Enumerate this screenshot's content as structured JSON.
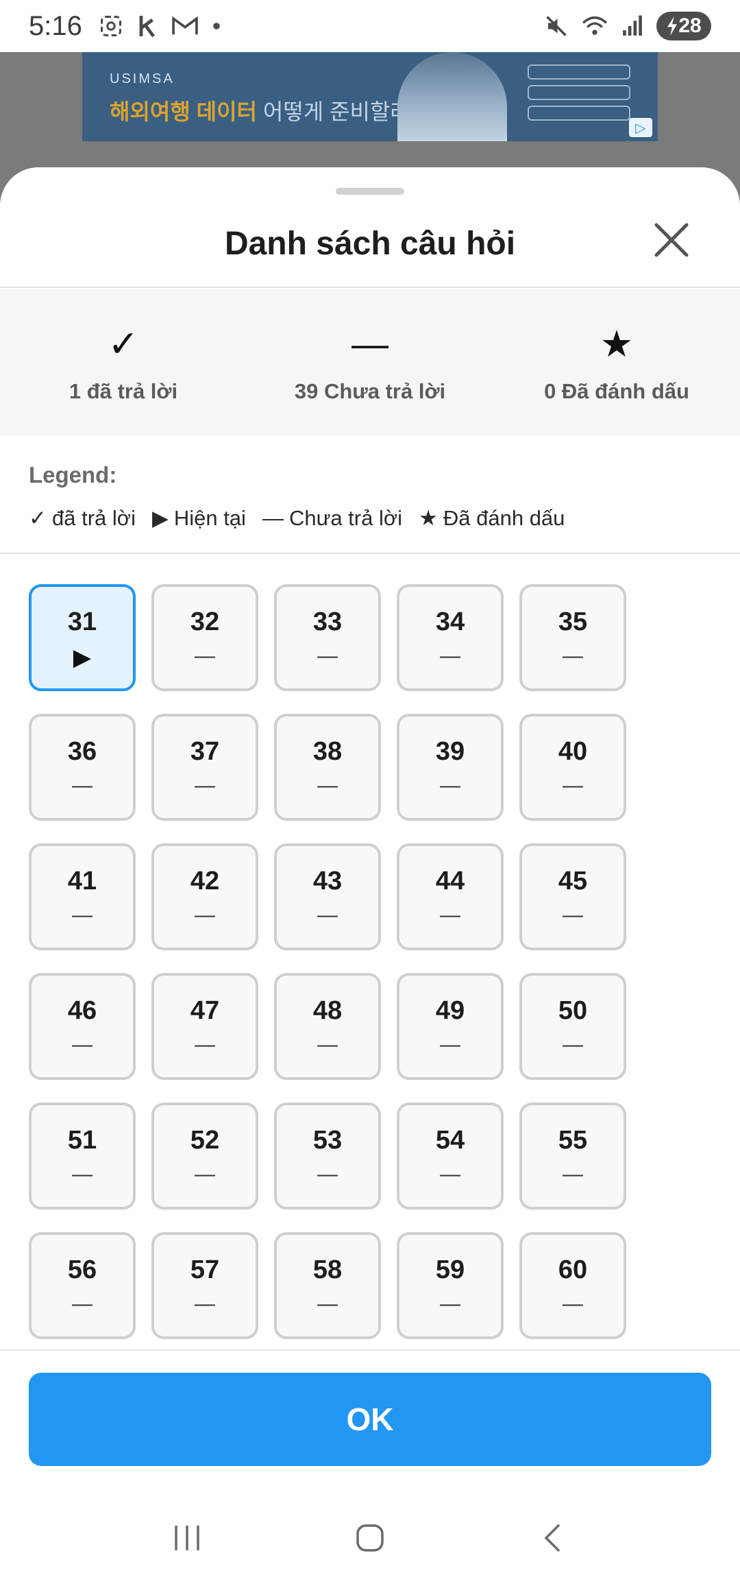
{
  "status_bar": {
    "time": "5:16",
    "left_icons": [
      "screenshot-icon",
      "k-app-icon",
      "gmail-icon",
      "dot-icon"
    ],
    "right_icons": [
      "mute-icon",
      "wifi-icon",
      "signal-icon"
    ],
    "battery": "28"
  },
  "ad": {
    "brand": "USIMSA",
    "headline_highlight": "해외여행 데이터",
    "headline_rest": " 어떻게 준비할래?"
  },
  "sheet": {
    "title": "Danh sách câu hỏi",
    "close_icon": "close-icon"
  },
  "summary": [
    {
      "icon": "✓",
      "label": "1 đã trả lời"
    },
    {
      "icon": "—",
      "label": "39 Chưa trả lời"
    },
    {
      "icon": "★",
      "label": "0 Đã đánh dấu"
    }
  ],
  "legend": {
    "title": "Legend:",
    "items": [
      {
        "icon": "✓",
        "label": "đã trả lời"
      },
      {
        "icon": "▶",
        "label": "Hiện tại"
      },
      {
        "icon": "—",
        "label": "Chưa trả lời"
      },
      {
        "icon": "★",
        "label": "Đã đánh dấu"
      }
    ]
  },
  "questions": [
    {
      "number": "31",
      "status": "▶",
      "current": true
    },
    {
      "number": "32",
      "status": "—",
      "current": false
    },
    {
      "number": "33",
      "status": "—",
      "current": false
    },
    {
      "number": "34",
      "status": "—",
      "current": false
    },
    {
      "number": "35",
      "status": "—",
      "current": false
    },
    {
      "number": "36",
      "status": "—",
      "current": false
    },
    {
      "number": "37",
      "status": "—",
      "current": false
    },
    {
      "number": "38",
      "status": "—",
      "current": false
    },
    {
      "number": "39",
      "status": "—",
      "current": false
    },
    {
      "number": "40",
      "status": "—",
      "current": false
    },
    {
      "number": "41",
      "status": "—",
      "current": false
    },
    {
      "number": "42",
      "status": "—",
      "current": false
    },
    {
      "number": "43",
      "status": "—",
      "current": false
    },
    {
      "number": "44",
      "status": "—",
      "current": false
    },
    {
      "number": "45",
      "status": "—",
      "current": false
    },
    {
      "number": "46",
      "status": "—",
      "current": false
    },
    {
      "number": "47",
      "status": "—",
      "current": false
    },
    {
      "number": "48",
      "status": "—",
      "current": false
    },
    {
      "number": "49",
      "status": "—",
      "current": false
    },
    {
      "number": "50",
      "status": "—",
      "current": false
    },
    {
      "number": "51",
      "status": "—",
      "current": false
    },
    {
      "number": "52",
      "status": "—",
      "current": false
    },
    {
      "number": "53",
      "status": "—",
      "current": false
    },
    {
      "number": "54",
      "status": "—",
      "current": false
    },
    {
      "number": "55",
      "status": "—",
      "current": false
    },
    {
      "number": "56",
      "status": "—",
      "current": false
    },
    {
      "number": "57",
      "status": "—",
      "current": false
    },
    {
      "number": "58",
      "status": "—",
      "current": false
    },
    {
      "number": "59",
      "status": "—",
      "current": false
    },
    {
      "number": "60",
      "status": "—",
      "current": false
    }
  ],
  "ok_button": {
    "label": "OK"
  },
  "colors": {
    "accent": "#2196f3",
    "current_bg": "#e4f2fd",
    "cell_border": "#cfcfcf"
  },
  "nav_bar": [
    "recent-apps-icon",
    "home-icon",
    "back-icon"
  ]
}
